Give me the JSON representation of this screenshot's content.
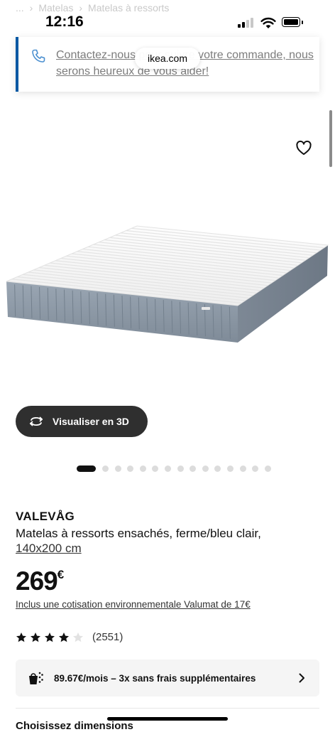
{
  "breadcrumb": {
    "items": [
      "...",
      "Matelas",
      "Matelas à ressorts"
    ]
  },
  "status_bar": {
    "time": "12:16"
  },
  "contact_banner": {
    "text": "Contactez-nous pour suivre votre commande, nous serons heureux de vous aider!",
    "icon": "phone-icon"
  },
  "browser": {
    "url": "ikea.com"
  },
  "gallery": {
    "view_3d_label": "Visualiser en 3D",
    "image_count": 15,
    "active_index": 0,
    "image_alt_colors": {
      "top": "#f7f7f7",
      "side": "#8e9aa8"
    }
  },
  "product": {
    "name": "VALEVÅG",
    "description": "Matelas à ressorts ensachés, ferme/bleu clair,",
    "size": "140x200 cm",
    "price": "269",
    "currency": "€",
    "eco_fee": "Inclus une cotisation environnementale Valumat de 17€",
    "rating": 4,
    "rating_max": 5,
    "review_count": "(2551)"
  },
  "financing": {
    "text": "89.67€/mois – 3x sans frais supplémentaires"
  },
  "next_section": {
    "heading": "Choisissez dimensions"
  },
  "colors": {
    "accent": "#0058a3",
    "dark_button": "#2f2f2f"
  }
}
